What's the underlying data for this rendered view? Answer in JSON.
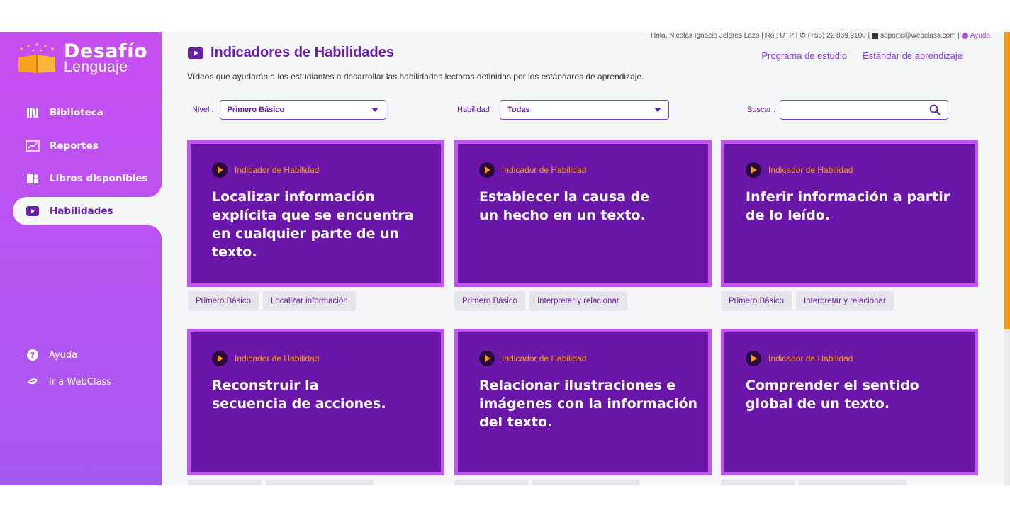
{
  "brand": {
    "line1": "Desafío",
    "line2": "Lenguaje"
  },
  "sidebar": {
    "items": [
      {
        "label": "Biblioteca",
        "icon": "books-icon"
      },
      {
        "label": "Reportes",
        "icon": "chart-icon"
      },
      {
        "label": "Libros disponibles",
        "icon": "book-stack-icon"
      },
      {
        "label": "Habilidades",
        "icon": "video-icon",
        "active": true
      }
    ],
    "bottom": [
      {
        "label": "Ayuda",
        "icon": "help-icon"
      },
      {
        "label": "Ir a WebClass",
        "icon": "webclass-icon"
      }
    ]
  },
  "topbar": {
    "greeting": "Hola, Nicolás Ignacio Jeldres Lazo | Rol: UTP |",
    "phone": "(+56) 22 869 9100 |",
    "email": "soporte@webclass.com |",
    "help": "Ayuda"
  },
  "header": {
    "title": "Indicadores de Habilidades",
    "links": [
      "Programa de estudio",
      "Estándar de aprendizaje"
    ],
    "description": "Vídeos que ayudarán a los estudiantes a desarrollar las habilidades lectoras definidas por los estándares de aprendizaje."
  },
  "filters": {
    "nivel_label": "Nivel :",
    "nivel_value": "Primero Básico",
    "habilidad_label": "Habilidad :",
    "habilidad_value": "Todas",
    "buscar_label": "Buscar :",
    "buscar_value": ""
  },
  "cards": [
    {
      "kicker": "Indicador de Habilidad",
      "title": "Localizar información explícita que se encuentra en cualquier parte de un texto.",
      "tags": [
        "Primero Básico",
        "Localizar información"
      ]
    },
    {
      "kicker": "Indicador de Habilidad",
      "title": "Establecer la causa de un hecho en un texto.",
      "tags": [
        "Primero Básico",
        "Interpretar y relacionar"
      ]
    },
    {
      "kicker": "Indicador de Habilidad",
      "title": "Inferir información a partir de lo leído.",
      "tags": [
        "Primero Básico",
        "Interpretar y relacionar"
      ]
    },
    {
      "kicker": "Indicador de Habilidad",
      "title": "Reconstruir la secuencia de acciones.",
      "tags": []
    },
    {
      "kicker": "Indicador de Habilidad",
      "title": "Relacionar ilustraciones e imágenes con la información del texto.",
      "tags": []
    },
    {
      "kicker": "Indicador de Habilidad",
      "title": "Comprender el sentido global de un texto.",
      "tags": []
    }
  ],
  "colors": {
    "sidebar_top": "#c94ef2",
    "sidebar_bottom": "#a659ef",
    "card_bg": "#6a16a9",
    "card_border": "#c057f4",
    "accent": "#f5a000",
    "primary_text": "#6a1fa8"
  }
}
